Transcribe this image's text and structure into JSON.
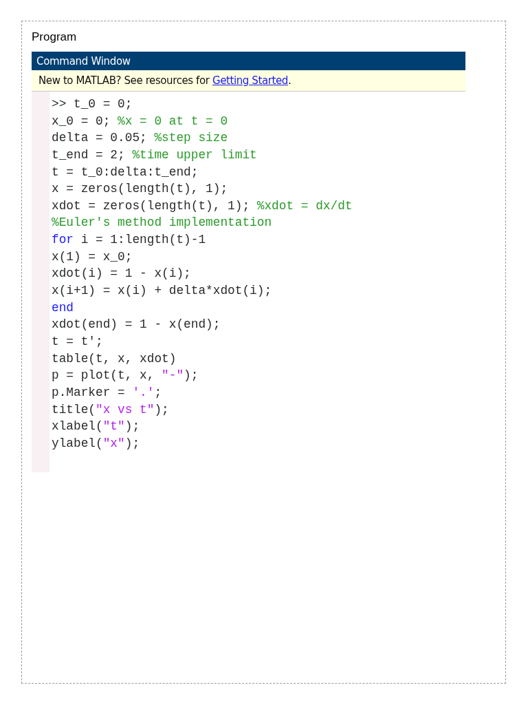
{
  "heading": "Program",
  "command_window": {
    "title": "Command Window",
    "notice": {
      "text": "New to MATLAB? See resources for ",
      "link": "Getting Started",
      "end": "."
    },
    "code_lines": [
      {
        "segments": [
          {
            "kind": "code",
            "text": ">> t_0 = 0;"
          }
        ]
      },
      {
        "segments": [
          {
            "kind": "code",
            "text": "x_0 = 0; "
          },
          {
            "kind": "comment",
            "text": "%x = 0 at t = 0"
          }
        ]
      },
      {
        "segments": [
          {
            "kind": "code",
            "text": "delta = 0.05; "
          },
          {
            "kind": "comment",
            "text": "%step size"
          }
        ]
      },
      {
        "segments": [
          {
            "kind": "code",
            "text": "t_end = 2; "
          },
          {
            "kind": "comment",
            "text": "%time upper limit"
          }
        ]
      },
      {
        "segments": [
          {
            "kind": "code",
            "text": "t = t_0:delta:t_end;"
          }
        ]
      },
      {
        "segments": [
          {
            "kind": "code",
            "text": "x = zeros(length(t), 1);"
          }
        ]
      },
      {
        "segments": [
          {
            "kind": "code",
            "text": "xdot = zeros(length(t), 1); "
          },
          {
            "kind": "comment",
            "text": "%xdot = dx/dt"
          }
        ]
      },
      {
        "segments": [
          {
            "kind": "comment",
            "text": "%Euler's method implementation"
          }
        ]
      },
      {
        "segments": [
          {
            "kind": "keyword",
            "text": "for"
          },
          {
            "kind": "code",
            "text": " i = 1:length(t)-1"
          }
        ]
      },
      {
        "segments": [
          {
            "kind": "code",
            "text": "x(1) = x_0;"
          }
        ]
      },
      {
        "segments": [
          {
            "kind": "code",
            "text": "xdot(i) = 1 - x(i);"
          }
        ]
      },
      {
        "segments": [
          {
            "kind": "code",
            "text": "x(i+1) = x(i) + delta*xdot(i);"
          }
        ]
      },
      {
        "segments": [
          {
            "kind": "keyword",
            "text": "end"
          }
        ]
      },
      {
        "segments": [
          {
            "kind": "code",
            "text": "xdot(end) = 1 - x(end);"
          }
        ]
      },
      {
        "segments": [
          {
            "kind": "code",
            "text": "t = t';"
          }
        ]
      },
      {
        "segments": [
          {
            "kind": "code",
            "text": "table(t, x, xdot)"
          }
        ]
      },
      {
        "segments": [
          {
            "kind": "code",
            "text": "p = plot(t, x, "
          },
          {
            "kind": "string",
            "text": "\"-\""
          },
          {
            "kind": "code",
            "text": ");"
          }
        ]
      },
      {
        "segments": [
          {
            "kind": "code",
            "text": "p.Marker = "
          },
          {
            "kind": "string",
            "text": "'.'"
          },
          {
            "kind": "code",
            "text": ";"
          }
        ]
      },
      {
        "segments": [
          {
            "kind": "code",
            "text": "title("
          },
          {
            "kind": "string",
            "text": "\"x vs t\""
          },
          {
            "kind": "code",
            "text": ");"
          }
        ]
      },
      {
        "segments": [
          {
            "kind": "code",
            "text": "xlabel("
          },
          {
            "kind": "string",
            "text": "\"t\""
          },
          {
            "kind": "code",
            "text": ");"
          }
        ]
      },
      {
        "segments": [
          {
            "kind": "code",
            "text": "ylabel("
          },
          {
            "kind": "string",
            "text": "\"x\""
          },
          {
            "kind": "code",
            "text": ");"
          }
        ]
      }
    ]
  }
}
